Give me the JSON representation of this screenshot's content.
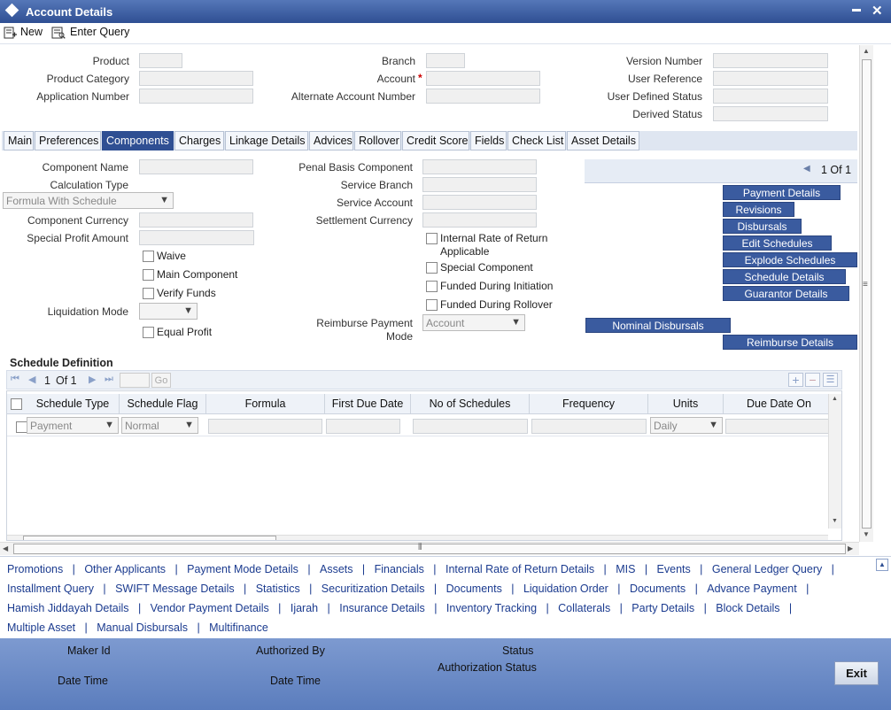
{
  "window": {
    "title": "Account Details",
    "min": "▬",
    "close": "✕"
  },
  "toolbar": {
    "new": "New",
    "enter_query": "Enter Query"
  },
  "header": {
    "product": "Product",
    "product_category": "Product Category",
    "application_number": "Application Number",
    "branch": "Branch",
    "account": "Account",
    "account_required": "*",
    "alternate_account_number": "Alternate Account Number",
    "version_number": "Version Number",
    "user_reference": "User Reference",
    "user_defined_status": "User Defined Status",
    "derived_status": "Derived Status"
  },
  "tabs": [
    "Main",
    "Preferences",
    "Components",
    "Charges",
    "Linkage Details",
    "Advices",
    "Rollover",
    "Credit Score",
    "Fields",
    "Check List",
    "Asset Details"
  ],
  "components": {
    "component_name": "Component Name",
    "calculation_type": "Calculation Type",
    "calculation_type_value": "Formula With Schedule",
    "component_currency": "Component Currency",
    "special_profit_amount": "Special Profit Amount",
    "waive": "Waive",
    "main_component": "Main Component",
    "verify_funds": "Verify Funds",
    "liquidation_mode": "Liquidation Mode",
    "equal_profit": "Equal Profit",
    "penal_basis_component": "Penal Basis Component",
    "service_branch": "Service Branch",
    "service_account": "Service Account",
    "settlement_currency": "Settlement Currency",
    "irr_applicable_1": "Internal Rate of Return",
    "irr_applicable_2": "Applicable",
    "special_component": "Special Component",
    "funded_during_initiation": "Funded During Initiation",
    "funded_during_rollover": "Funded During Rollover",
    "reimburse_payment_mode_1": "Reimburse Payment",
    "reimburse_payment_mode_2": "Mode",
    "reimburse_payment_mode_value": "Account",
    "pager": "1 Of 1"
  },
  "side_buttons": {
    "payment_details": "Payment Details",
    "revisions": "Revisions",
    "disbursals": "Disbursals",
    "edit_schedules": "Edit Schedules",
    "explode_schedules": "Explode Schedules",
    "schedule_details": "Schedule Details",
    "guarantor_details": "Guarantor Details",
    "nominal_disbursals": "Nominal Disbursals",
    "reimburse_details": "Reimburse Details"
  },
  "schedule": {
    "title": "Schedule Definition",
    "page": "1",
    "of": "Of 1",
    "go": "Go",
    "columns": [
      "Schedule Type",
      "Schedule Flag",
      "Formula",
      "First Due Date",
      "No of Schedules",
      "Frequency",
      "Units",
      "Due Date On"
    ],
    "row": {
      "schedule_type": "Payment",
      "schedule_flag": "Normal",
      "units": "Daily"
    }
  },
  "links": {
    "row1": [
      "Promotions",
      "Other Applicants",
      "Payment Mode Details",
      "Assets",
      "Financials",
      "Internal Rate of Return Details",
      "MIS",
      "Events",
      "General Ledger Query"
    ],
    "row2": [
      "Installment Query",
      "SWIFT Message Details",
      "Statistics",
      "Securitization Details",
      "Documents",
      "Liquidation Order",
      "Documents",
      "Advance Payment"
    ],
    "row3": [
      "Hamish Jiddayah Details",
      "Vendor Payment Details",
      "Ijarah",
      "Insurance Details",
      "Inventory Tracking",
      "Collaterals",
      "Party Details",
      "Block Details"
    ],
    "row4": [
      "Multiple Asset",
      "Manual Disbursals",
      "Multifinance"
    ]
  },
  "footer": {
    "maker_id": "Maker Id",
    "date_time_1": "Date Time",
    "authorized_by": "Authorized By",
    "date_time_2": "Date Time",
    "status": "Status",
    "authorization_status": "Authorization Status",
    "exit": "Exit"
  },
  "colors": {
    "title_bar": "#2f4f93",
    "active_tab": "#2f4f93",
    "button": "#3a5b9f",
    "link": "#1b3b8f",
    "footer": "#6a8ac6"
  }
}
